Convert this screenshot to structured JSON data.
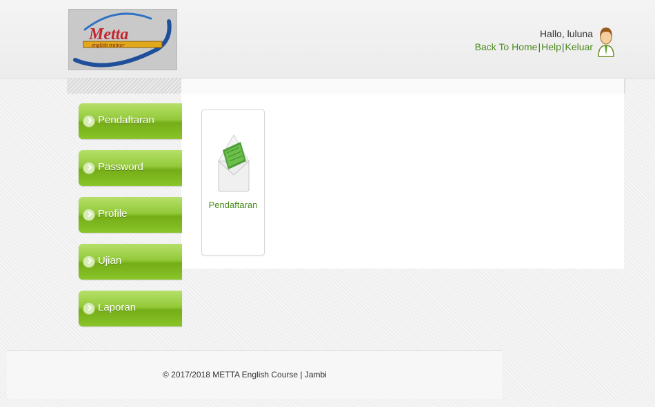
{
  "header": {
    "logo_text": "Metta",
    "logo_tagline": "english trainer",
    "greeting": "Hallo, luluna",
    "links": {
      "home": "Back To Home",
      "help": "Help",
      "logout": "Keluar",
      "separator": "|"
    }
  },
  "sidebar": {
    "items": [
      {
        "label": "Pendaftaran"
      },
      {
        "label": "Password"
      },
      {
        "label": "Profile"
      },
      {
        "label": "Ujian"
      },
      {
        "label": "Laporan"
      }
    ]
  },
  "main": {
    "cards": [
      {
        "label": "Pendaftaran",
        "icon": "envelope-icon"
      }
    ]
  },
  "footer": {
    "text": "© 2017/2018 METTA English Course | Jambi"
  },
  "colors": {
    "accent_green": "#74ad17",
    "link_green": "#4a8a1c"
  }
}
